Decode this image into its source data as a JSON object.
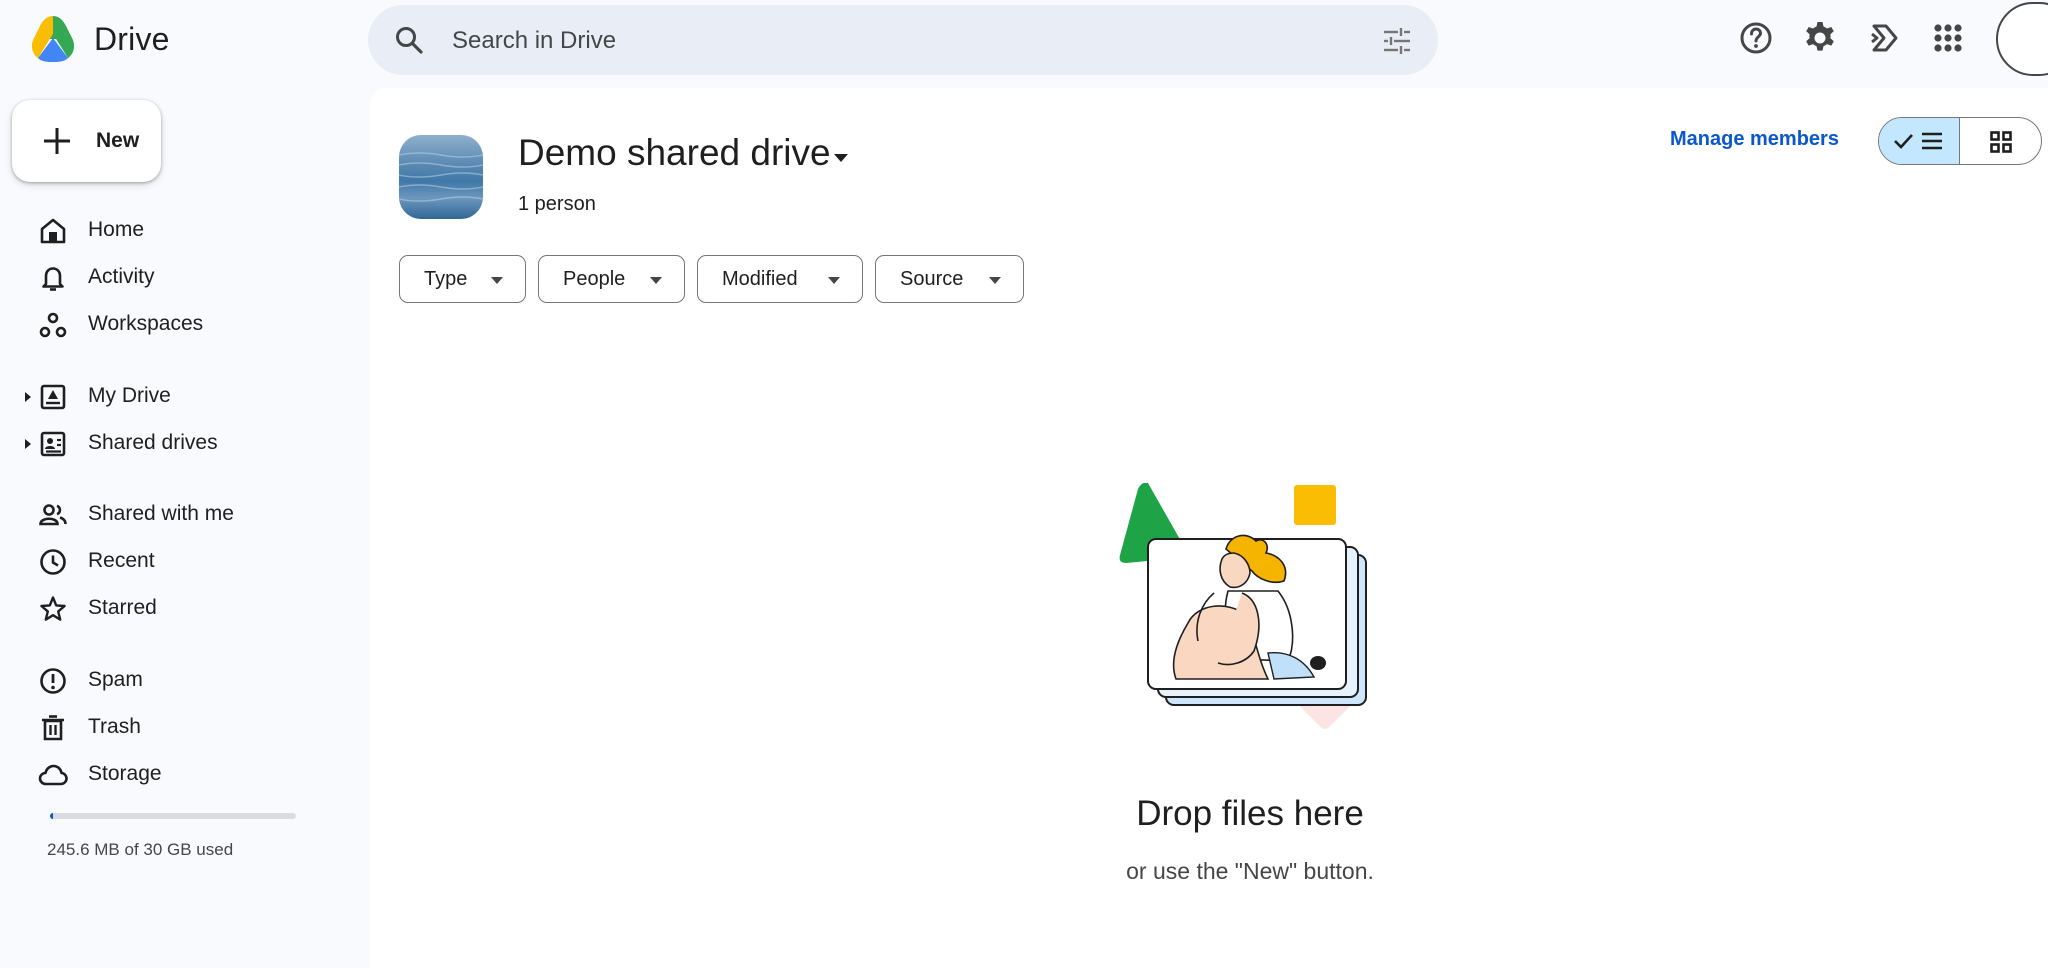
{
  "app": {
    "name": "Drive"
  },
  "search": {
    "placeholder": "Search in Drive"
  },
  "sidebar": {
    "new_label": "New",
    "items": [
      {
        "label": "Home",
        "icon": "home-icon"
      },
      {
        "label": "Activity",
        "icon": "bell-icon"
      },
      {
        "label": "Workspaces",
        "icon": "workspaces-icon"
      },
      {
        "label": "My Drive",
        "icon": "my-drive-icon"
      },
      {
        "label": "Shared drives",
        "icon": "shared-drives-icon"
      },
      {
        "label": "Shared with me",
        "icon": "people-icon"
      },
      {
        "label": "Recent",
        "icon": "clock-icon"
      },
      {
        "label": "Starred",
        "icon": "star-icon"
      },
      {
        "label": "Spam",
        "icon": "spam-icon"
      },
      {
        "label": "Trash",
        "icon": "trash-icon"
      },
      {
        "label": "Storage",
        "icon": "cloud-icon"
      }
    ],
    "storage": {
      "used_text": "245.6 MB of 30 GB used",
      "used_fraction": 0.008
    }
  },
  "main": {
    "title": "Demo shared drive",
    "subtitle": "1 person",
    "manage_label": "Manage members",
    "filters": [
      "Type",
      "People",
      "Modified",
      "Source"
    ],
    "view": "list",
    "empty": {
      "title": "Drop files here",
      "subtitle": "or use the \"New\" button."
    }
  },
  "colors": {
    "accent": "#0b57d0",
    "selected_toggle": "#c2e7ff",
    "search_bg": "#e9eef6",
    "page_bg": "#f8fafd"
  }
}
